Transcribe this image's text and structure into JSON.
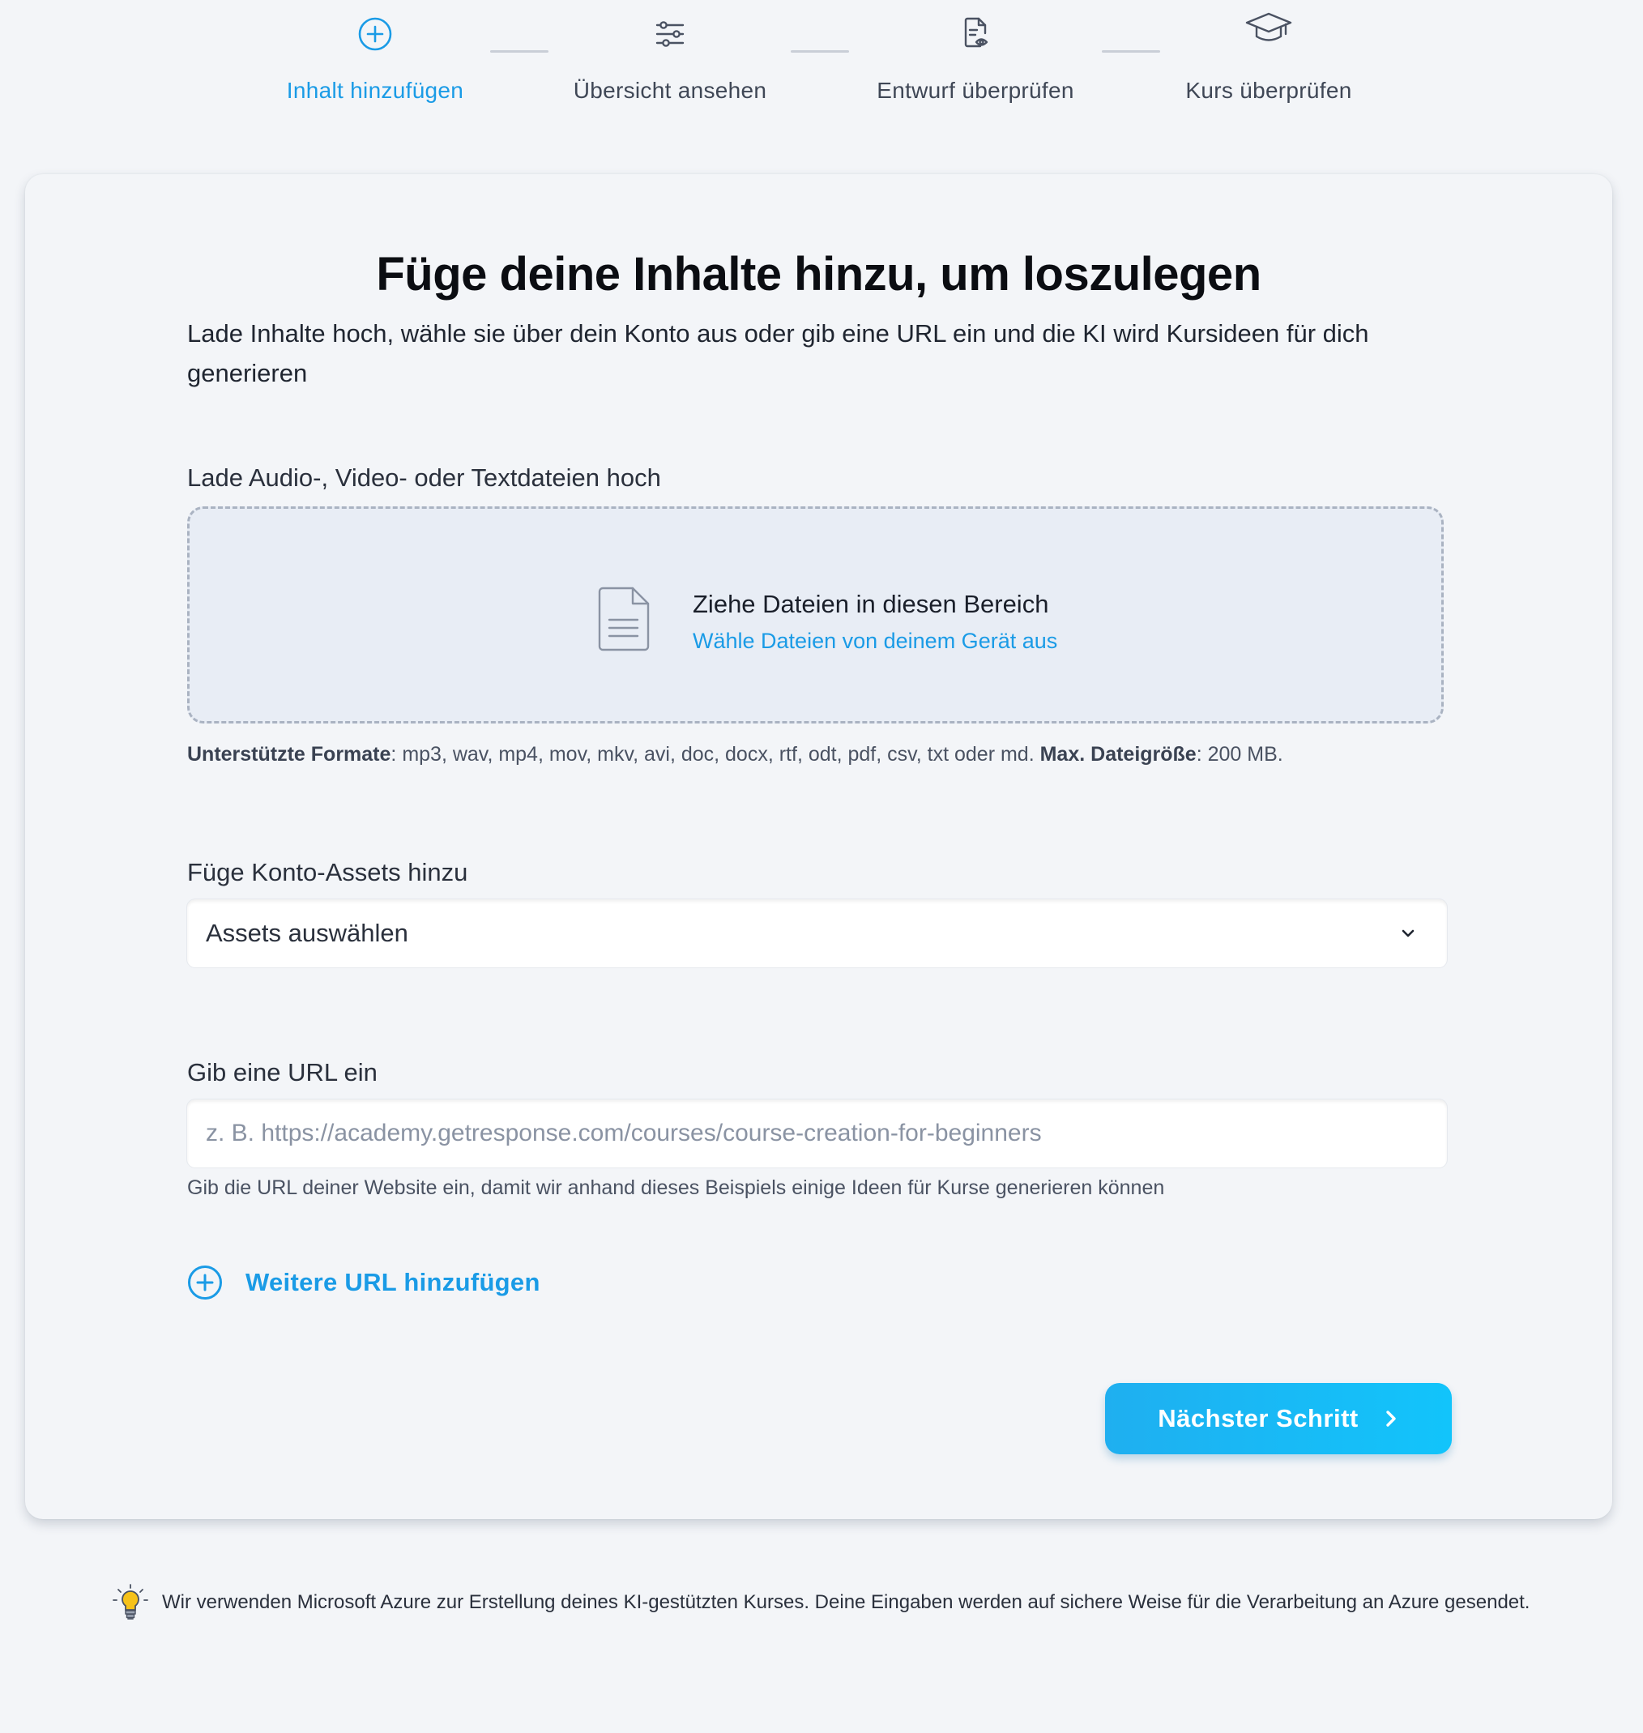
{
  "stepper": {
    "steps": [
      {
        "label": "Inhalt hinzufügen",
        "icon": "plus-circle-icon",
        "active": true
      },
      {
        "label": "Übersicht ansehen",
        "icon": "sliders-icon",
        "active": false
      },
      {
        "label": "Entwurf überprüfen",
        "icon": "document-eye-icon",
        "active": false
      },
      {
        "label": "Kurs überprüfen",
        "icon": "graduation-cap-icon",
        "active": false
      }
    ]
  },
  "main": {
    "title": "Füge deine Inhalte hinzu, um loszulegen",
    "intro": "Lade Inhalte hoch, wähle sie über dein Konto aus oder gib eine URL ein und die KI wird Kursideen für dich generieren",
    "upload": {
      "label": "Lade Audio-, Video- oder Textdateien hoch",
      "drop_text": "Ziehe Dateien in diesen Bereich",
      "choose_link": "Wähle Dateien von deinem Gerät aus",
      "formats_label": "Unterstützte Formate",
      "formats_value": ": mp3, wav, mp4, mov, mkv, avi, doc, docx, rtf, odt, pdf, csv, txt oder md. ",
      "max_size_label": "Max. Dateigröße",
      "max_size_value": ": 200 MB."
    },
    "assets": {
      "label": "Füge Konto-Assets hinzu",
      "selected": "Assets auswählen"
    },
    "url": {
      "label": "Gib eine URL ein",
      "value": "",
      "placeholder": "z. B. https://academy.getresponse.com/courses/course-creation-for-beginners",
      "help": "Gib die URL deiner Website ein, damit wir anhand dieses Beispiels einige Ideen für Kurse generieren können",
      "add_more": "Weitere URL hinzufügen"
    },
    "next_button": "Nächster Schritt"
  },
  "footer": {
    "note": "Wir verwenden Microsoft Azure zur Erstellung deines KI-gestützten Kurses. Deine Eingaben werden auf sichere Weise für die Verarbeitung an Azure gesendet."
  },
  "colors": {
    "accent": "#1a9be6",
    "button_gradient_start": "#1faff0",
    "button_gradient_end": "#12c4fb",
    "background": "#f3f5f8",
    "dropzone_bg": "#e8edf5"
  }
}
